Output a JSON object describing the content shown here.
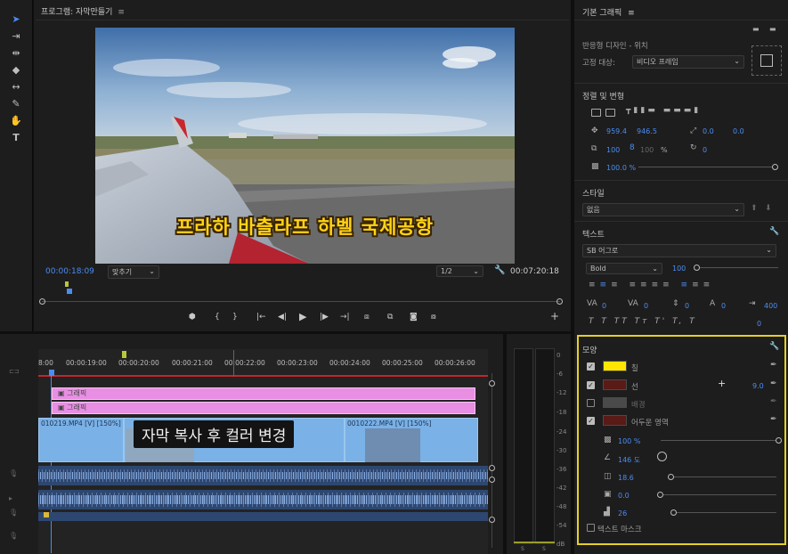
{
  "tools": {
    "icons": [
      "selection-tool-icon",
      "track-select-tool-icon",
      "ripple-edit-tool-icon",
      "razor-tool-icon",
      "slip-tool-icon",
      "pen-tool-icon",
      "hand-tool-icon",
      "type-tool-icon"
    ]
  },
  "program": {
    "title": "프로그램: 자막만들기",
    "menu": "≡",
    "subtitle": "프라하 바츨라프 하벨 국제공항",
    "timecode": "00:00:18:09",
    "fit": "맞추기",
    "resolution": "1/2",
    "duration": "00:07:20:18"
  },
  "graphics": {
    "title": "기본 그래픽",
    "menu": "≡",
    "responsive": "반응형 디자인 - 위치",
    "pin_label": "고정 대상:",
    "pin_value": "비디오 프레임",
    "align_title": "정렬 및 변형",
    "pos_x": "959.4",
    "pos_y": "946.5",
    "anchor_x": "0.0",
    "anchor_y": "0.0",
    "scale": "100",
    "scale2": "100",
    "percent": "%",
    "rotation": "0",
    "opacity": "100.0 %",
    "style_title": "스타일",
    "style_value": "없음",
    "text_title": "텍스트",
    "font": "SB 어그로",
    "font_style": "Bold",
    "font_size": "100",
    "kerning": "0",
    "tracking": "0",
    "leading": "0",
    "baseline": "0",
    "tsume": "0",
    "tab_width": "400",
    "tt_buttons": [
      "T",
      "T",
      "TT",
      "Tт",
      "T'",
      "T,",
      "T"
    ],
    "appearance_title": "모양",
    "fill_label": "칠",
    "stroke_label": "선",
    "stroke_width": "9.0",
    "background_label": "배경",
    "shadow_label": "어두운 영역",
    "shadow_opacity": "100 %",
    "shadow_angle": "146 도",
    "shadow_distance": "18.6",
    "shadow_size": "0.0",
    "shadow_blur": "26",
    "mask_label": "텍스트 마스크",
    "colors": {
      "fill": "#ffe600",
      "stroke": "#5a1a16",
      "background": "#4a4a4a",
      "shadow": "#5a1a16",
      "highlight": "#e5cf2a"
    }
  },
  "timeline": {
    "ruler": [
      "8:00",
      "00:00:19:00",
      "00:00:20:00",
      "00:00:21:00",
      "00:00:22:00",
      "00:00:23:00",
      "00:00:24:00",
      "00:00:25:00",
      "00:00:26:00"
    ],
    "graphic_clip_1": "그래픽",
    "graphic_clip_2": "그래픽",
    "video_clip_1": "010219.MP4 [V] [150%]",
    "video_clip_2": "0010222.MP4 [V] [150%]",
    "overlay_caption": "자막 복사 후 컬러 변경"
  },
  "meter": {
    "db_labels": [
      "0",
      "-6",
      "-12",
      "-18",
      "-24",
      "-30",
      "-36",
      "-42",
      "-48",
      "-54",
      "dB"
    ],
    "bottom": [
      "S",
      "S"
    ]
  }
}
